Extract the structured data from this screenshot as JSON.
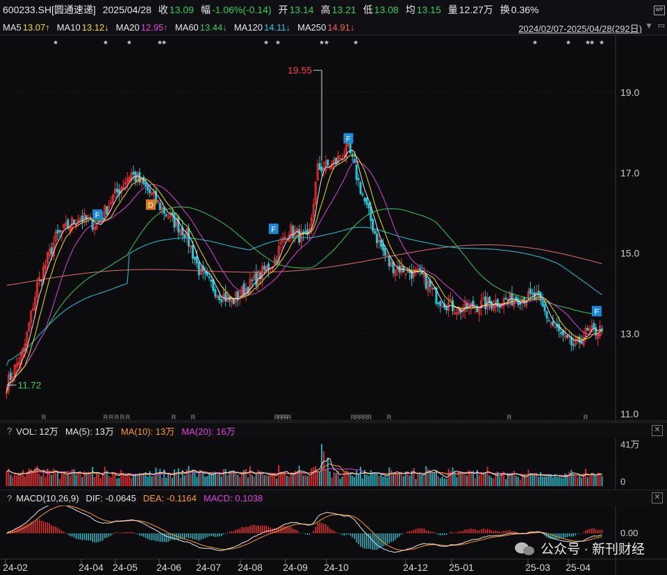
{
  "header": {
    "code": "600233.SH[圆通速递]",
    "date": "2025/04/28",
    "close_label": "收",
    "close": "13.09",
    "change_label": "幅",
    "change": "-1.06%(-0.14)",
    "open_label": "开",
    "open": "13.14",
    "high_label": "高",
    "high": "13.21",
    "low_label": "低",
    "low": "13.08",
    "avg_label": "均",
    "avg": "13.15",
    "vol_label": "量",
    "vol": "12.27万",
    "turnover_label": "换",
    "turnover": "0.36%"
  },
  "ma_bar": {
    "ma5_label": "MA5",
    "ma5": "13.07↑",
    "ma10_label": "MA10",
    "ma10": "13.12↓",
    "ma20_label": "MA20",
    "ma20": "12.95↑",
    "ma60_label": "MA60",
    "ma60": "13.44↓",
    "ma120_label": "MA120",
    "ma120": "14.11↓",
    "ma250_label": "MA250",
    "ma250": "14.91↓",
    "range": "2024/02/07-2025/04/28(292日)"
  },
  "volume_panel": {
    "help": "?",
    "title": "VOL: 12万",
    "ma5": "MA(5): 13万",
    "ma10": "MA(10): 13万",
    "ma20": "MA(20): 16万",
    "close": "✕"
  },
  "macd_panel": {
    "help": "?",
    "title": "MACD(10,26,9)",
    "dif": "DIF: -0.0645",
    "dea": "DEA: -0.1164",
    "macd": "MACD: 0.1038",
    "close": "✕"
  },
  "watermark": "公众号 · 新刊财经",
  "colors": {
    "up": "#ff3030",
    "down": "#22c8d8",
    "ma5": "#e8e8e8",
    "ma10": "#f0e000",
    "ma20": "#e040e0",
    "ma60": "#2ecf5a",
    "ma120": "#22c8e0",
    "ma250": "#e07070",
    "dif": "#e8e8e8",
    "dea": "#ff9c1a"
  },
  "chart_data": {
    "type": "candlestick",
    "x_ticks": [
      "24-02",
      "24-04",
      "24-05",
      "24-06",
      "24-07",
      "24-08",
      "24-09",
      "24-10",
      "24-12",
      "25-01",
      "25-03",
      "25-04"
    ],
    "y_ticks": [
      "19.0",
      "17.0",
      "15.0",
      "13.0",
      "11.0"
    ],
    "ylim": [
      10.9,
      20.4
    ],
    "annotations": [
      {
        "text": "19.55",
        "kind": "high"
      },
      {
        "text": "11.72",
        "kind": "low"
      }
    ],
    "markers": [
      {
        "label": "F"
      },
      {
        "label": "D"
      },
      {
        "label": "F"
      },
      {
        "label": "F"
      },
      {
        "label": "F"
      }
    ],
    "price_anchors": [
      [
        "24-02-07",
        11.72
      ],
      [
        "24-02-20",
        12.6
      ],
      [
        "24-03-01",
        14.2
      ],
      [
        "24-03-15",
        15.4
      ],
      [
        "24-04-01",
        15.9
      ],
      [
        "24-04-15",
        15.7
      ],
      [
        "24-04-25",
        16.3
      ],
      [
        "24-05-10",
        17.0
      ],
      [
        "24-05-22",
        16.6
      ],
      [
        "24-06-05",
        16.0
      ],
      [
        "24-06-20",
        15.5
      ],
      [
        "24-07-01",
        14.5
      ],
      [
        "24-07-15",
        14.0
      ],
      [
        "24-07-25",
        13.8
      ],
      [
        "24-08-10",
        14.3
      ],
      [
        "24-08-25",
        14.8
      ],
      [
        "24-09-05",
        15.6
      ],
      [
        "24-09-20",
        15.3
      ],
      [
        "24-09-27",
        17.1
      ],
      [
        "24-10-08",
        17.2
      ],
      [
        "24-10-20",
        17.6
      ],
      [
        "24-11-01",
        16.3
      ],
      [
        "24-11-10",
        15.4
      ],
      [
        "24-11-20",
        14.7
      ],
      [
        "24-12-01",
        14.6
      ],
      [
        "24-12-15",
        14.4
      ],
      [
        "24-12-25",
        13.9
      ],
      [
        "25-01-10",
        13.6
      ],
      [
        "25-01-25",
        13.7
      ],
      [
        "25-02-10",
        13.8
      ],
      [
        "25-02-25",
        13.9
      ],
      [
        "25-03-10",
        13.9
      ],
      [
        "25-03-20",
        13.3
      ],
      [
        "25-04-01",
        12.8
      ],
      [
        "25-04-08",
        12.7
      ],
      [
        "25-04-15",
        13.0
      ],
      [
        "25-04-28",
        13.09
      ]
    ],
    "ma_end_values": {
      "MA5": 13.07,
      "MA10": 13.12,
      "MA20": 12.95,
      "MA60": 13.44,
      "MA120": 14.11,
      "MA250": 14.91
    },
    "volume_ticks": [
      "41万",
      "0"
    ],
    "macd_ticks": [
      "0.00"
    ]
  }
}
